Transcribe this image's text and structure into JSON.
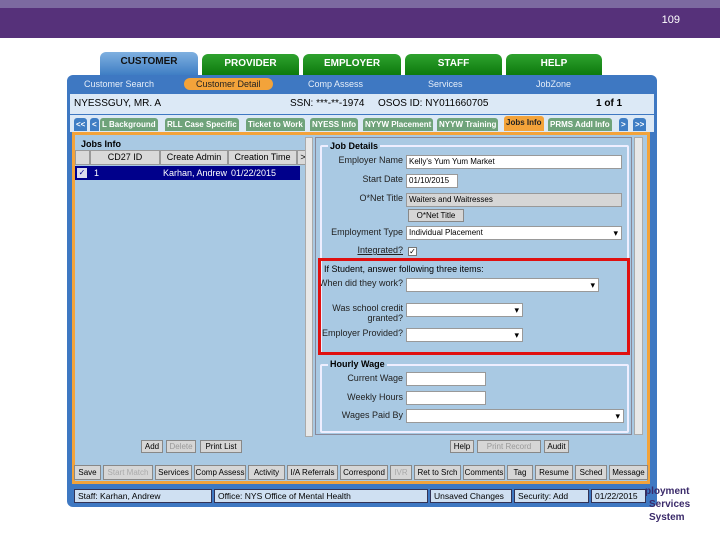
{
  "page_number": "109",
  "main_tabs": [
    "CUSTOMER",
    "PROVIDER",
    "EMPLOYER",
    "STAFF",
    "HELP"
  ],
  "sub_nav": [
    "Customer Search",
    "Customer Detail",
    "Comp Assess",
    "Services",
    "JobZone"
  ],
  "customer": {
    "name": "NYESSGUY, MR. A",
    "ssn": "SSN: ***-**-1974",
    "osos_id": "OSOS ID: NY011660705",
    "record": "1 of 1"
  },
  "sub_tabs": [
    "<<",
    "<",
    "L Background",
    "RLL Case Specific",
    "Ticket to Work",
    "NYESS Info",
    "NYYW Placement",
    "NYYW Training",
    "Jobs Info",
    "PRMS Addl Info",
    ">",
    ">>"
  ],
  "jobs_info": {
    "title": "Jobs Info",
    "columns": [
      "CD27 ID",
      "Create Admin",
      "Creation Time",
      ">"
    ],
    "rows": [
      {
        "checked": true,
        "id": "1",
        "admin": "Karhan, Andrew",
        "time": "01/22/2015"
      }
    ],
    "buttons": [
      "Add",
      "Delete",
      "Print List"
    ]
  },
  "job_details": {
    "title": "Job Details",
    "employer_name_label": "Employer Name",
    "employer_name": "Kelly's Yum Yum Market",
    "start_date_label": "Start Date",
    "start_date": "01/10/2015",
    "onet_title_label": "O*Net Title",
    "onet_title": "Waiters and Waitresses",
    "onet_button": "O*Net Title",
    "employment_type_label": "Employment Type",
    "employment_type": "Individual Placement",
    "integrated_label": "Integrated?",
    "integrated": true
  },
  "student": {
    "heading": "If Student, answer following three items:",
    "when_label": "When did they work?",
    "credit_label": "Was school credit granted?",
    "employer_label": "Employer Provided?"
  },
  "hourly_wage": {
    "title": "Hourly Wage",
    "current_wage_label": "Current Wage",
    "weekly_hours_label": "Weekly Hours",
    "wages_paid_by_label": "Wages Paid By"
  },
  "right_buttons": [
    "Help",
    "Print Record",
    "Audit"
  ],
  "toolbar": [
    "Save",
    "Start Match",
    "Services",
    "Comp Assess",
    "Activity",
    "I/A Referrals",
    "Correspond",
    "IVR",
    "Ret to Srch",
    "Comments",
    "Tag",
    "Resume",
    "Sched",
    "Message"
  ],
  "status": {
    "staff": "Staff: Karhan, Andrew",
    "office": "Office: NYS Office of Mental Health",
    "changes": "Unsaved Changes",
    "security": "Security: Add",
    "date": "01/22/2015"
  },
  "logo_text": [
    "ployment",
    "Services System"
  ],
  "colors": {
    "header": "#56317a",
    "accent": "#f3a33a",
    "highlight": "#e01010"
  }
}
